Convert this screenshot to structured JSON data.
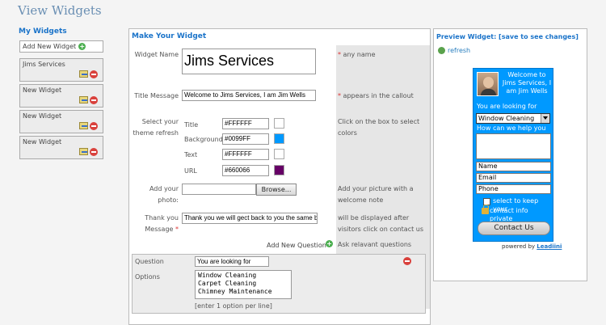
{
  "page": {
    "title": "View Widgets"
  },
  "sidebar": {
    "title": "My Widgets",
    "add_label": "Add New Widget",
    "items": [
      {
        "label": "Jims Services"
      },
      {
        "label": "New Widget"
      },
      {
        "label": "New Widget"
      },
      {
        "label": "New Widget"
      }
    ]
  },
  "form": {
    "title": "Make Your Widget",
    "widget_name": {
      "label": "Widget Name",
      "value": "Jims Services",
      "hint": "any name"
    },
    "title_message": {
      "label": "Title Message",
      "value": "Welcome to Jims Services, I am Jim Wells",
      "hint": "appears in the callout"
    },
    "theme": {
      "label_line1": "Select your",
      "label_line2": "theme refresh",
      "hint": "Click on the box to select colors",
      "rows": [
        {
          "label": "Title",
          "value": "#FFFFFF",
          "color": "#FFFFFF"
        },
        {
          "label": "Background",
          "value": "#0099FF",
          "color": "#0099FF"
        },
        {
          "label": "Text",
          "value": "#FFFFFF",
          "color": "#FFFFFF"
        },
        {
          "label": "URL",
          "value": "#660066",
          "color": "#660066"
        }
      ]
    },
    "photo": {
      "label_line1": "Add your",
      "label_line2": "photo:",
      "value": "",
      "browse_label": "Browse...",
      "hint": "Add your picture with a welcome note"
    },
    "thank_you": {
      "label_line1": "Thank you",
      "label_line2": "Message",
      "value": "Thank you we will gect back to you the same b",
      "hint": "will be displayed after visitors click on contact us"
    },
    "add_question": {
      "label": "Add New Question",
      "hint": "Ask relavant questions"
    },
    "question": {
      "label": "Question",
      "value": "You are looking for",
      "options_label": "Options",
      "options": "Window Cleaning\nCarpet Cleaning\nChimney Maintenance",
      "options_hint": "[enter 1 option per line]"
    }
  },
  "preview": {
    "title": "Preview Widget: [save to see changes]",
    "refresh_label": "refresh",
    "callout": "Welcome to Jims Services, I am Jim Wells",
    "question": "You are looking for",
    "selected_option": "Window Cleaning",
    "help_text": "How can we help you",
    "name_placeholder": "Name",
    "email_placeholder": "Email",
    "phone_placeholder": "Phone",
    "checkbox_label": "select to keep your",
    "private_label": "contact info private",
    "contact_button": "Contact Us",
    "powered_by": "powered by",
    "brand": "Leadiini"
  }
}
